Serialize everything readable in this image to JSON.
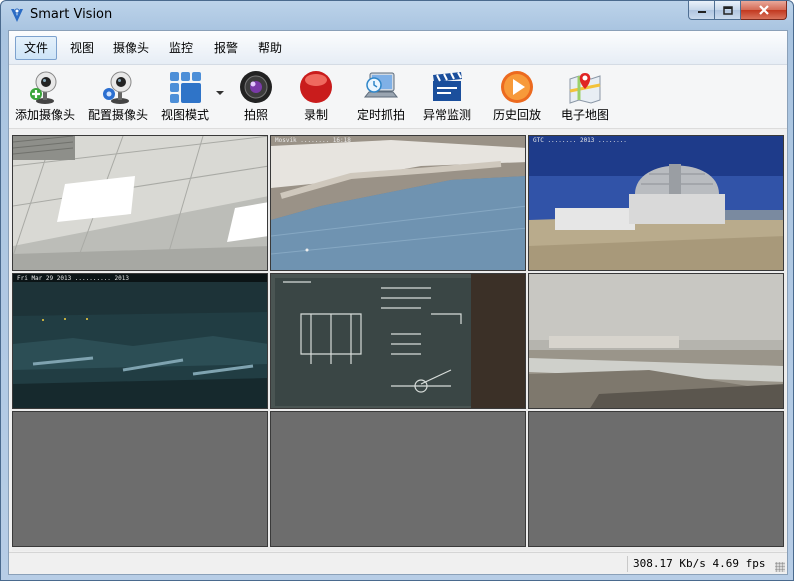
{
  "window": {
    "title": "Smart Vision"
  },
  "menu": {
    "items": [
      "文件",
      "视图",
      "摄像头",
      "监控",
      "报警",
      "帮助"
    ]
  },
  "toolbar": {
    "items": [
      {
        "label": "添加摄像头",
        "icon": "add-camera-icon"
      },
      {
        "label": "配置摄像头",
        "icon": "config-camera-icon"
      },
      {
        "label": "视图模式",
        "icon": "view-mode-icon"
      },
      {
        "label": "拍照",
        "icon": "camera-lens-icon"
      },
      {
        "label": "录制",
        "icon": "record-icon"
      },
      {
        "label": "定时抓拍",
        "icon": "timed-capture-icon"
      },
      {
        "label": "异常监测",
        "icon": "clapperboard-icon"
      },
      {
        "label": "历史回放",
        "icon": "play-icon"
      },
      {
        "label": "电子地图",
        "icon": "map-icon"
      }
    ]
  },
  "grid": {
    "layout": "3x3",
    "cells": [
      {
        "feed": "office-ceiling",
        "osd": ""
      },
      {
        "feed": "lake-town",
        "osd": "Mosvik ........ 16:18"
      },
      {
        "feed": "observatory-dome",
        "osd": "GTC ........ 2013 ........"
      },
      {
        "feed": "night-coast",
        "osd": "Fri Mar 29 2013 .......... 2013"
      },
      {
        "feed": "blackboard",
        "osd": ""
      },
      {
        "feed": "beach",
        "osd": ""
      },
      {
        "feed": "empty",
        "osd": ""
      },
      {
        "feed": "empty",
        "osd": ""
      },
      {
        "feed": "empty",
        "osd": ""
      }
    ]
  },
  "status": {
    "rate": "308.17 Kb/s 4.69 fps"
  },
  "colors": {
    "accent": "#7da2ce",
    "empty_cell": "#6d6d6d"
  }
}
